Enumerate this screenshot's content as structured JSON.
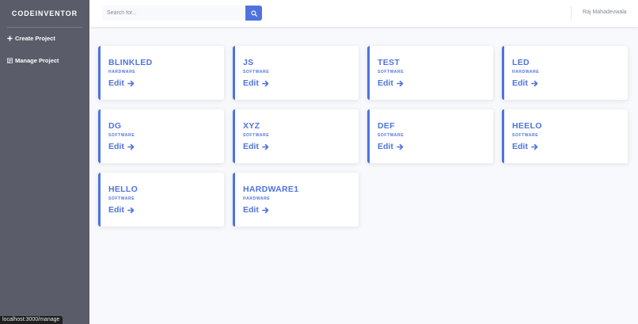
{
  "sidebar": {
    "brand": "CODEINVENTOR",
    "items": [
      {
        "label": "Create Project",
        "icon": "plus-icon"
      },
      {
        "label": "Manage Project",
        "icon": "list-icon"
      }
    ]
  },
  "topbar": {
    "search_placeholder": "Search for...",
    "user_name": "Raj Mahadevwala"
  },
  "projects": [
    {
      "name": "BLINKLED",
      "type": "HARDWARE",
      "edit": "Edit"
    },
    {
      "name": "JS",
      "type": "SOFTWARE",
      "edit": "Edit"
    },
    {
      "name": "TEST",
      "type": "SOFTWARE",
      "edit": "Edit"
    },
    {
      "name": "LED",
      "type": "HARDWARE",
      "edit": "Edit"
    },
    {
      "name": "DG",
      "type": "SOFTWARE",
      "edit": "Edit"
    },
    {
      "name": "XYZ",
      "type": "SOFTWARE",
      "edit": "Edit"
    },
    {
      "name": "DEF",
      "type": "SOFTWARE",
      "edit": "Edit"
    },
    {
      "name": "HEELO",
      "type": "SOFTWARE",
      "edit": "Edit"
    },
    {
      "name": "HELLO",
      "type": "SOFTWARE",
      "edit": "Edit"
    },
    {
      "name": "HARDWARE1",
      "type": "HARDWARE",
      "edit": "Edit"
    }
  ],
  "status_bar": {
    "url": "localhost:3000/manage"
  },
  "colors": {
    "accent": "#4e73df",
    "sidebar": "#5a5c69",
    "background": "#f8f9fc"
  }
}
